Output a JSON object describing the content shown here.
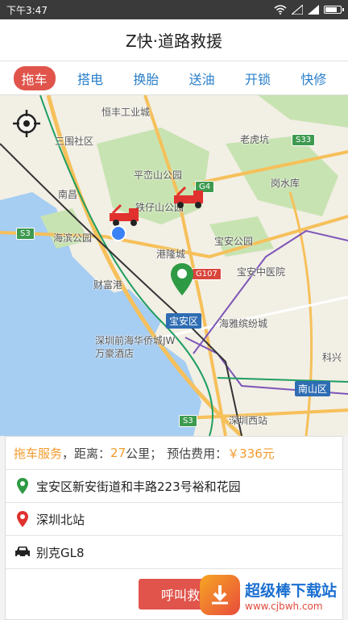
{
  "status": {
    "time": "下午3:47"
  },
  "header": {
    "title": "Z快·道路救援"
  },
  "tabs": [
    {
      "label": "拖车",
      "active": true
    },
    {
      "label": "搭电"
    },
    {
      "label": "换胎"
    },
    {
      "label": "送油"
    },
    {
      "label": "开锁"
    },
    {
      "label": "快修"
    }
  ],
  "map": {
    "labels": [
      "恒丰工业城",
      "三围社区",
      "老虎坑",
      "平峦山公园",
      "岗水库",
      "南昌",
      "铁仔山公园",
      "宝安公园",
      "海滨公园",
      "港隆城",
      "宝安中医院",
      "财富港",
      "海雅缤纷城",
      "深圳前海华侨城JW万豪酒店",
      "科兴",
      "深圳西站"
    ],
    "shields": [
      "S33",
      "G4",
      "S3",
      "G107",
      "S3"
    ],
    "districts": [
      "宝安区",
      "南山区"
    ]
  },
  "panel": {
    "service_label": "拖车服务",
    "distance_label": "，距离：",
    "distance_value": "27",
    "distance_unit": "公里；",
    "fee_label": "预估费用：",
    "fee_value": "￥336元",
    "origin": "宝安区新安街道和丰路223号裕和花园",
    "destination": "深圳北站",
    "vehicle": "别克GL8",
    "call_button": "呼叫救援"
  },
  "watermark": {
    "title": "超级棒下载站",
    "url": "www.cjbwh.com"
  },
  "colors": {
    "accent": "#e0544b",
    "tab_text": "#2a7fc9",
    "highlight": "#f29b2c"
  }
}
